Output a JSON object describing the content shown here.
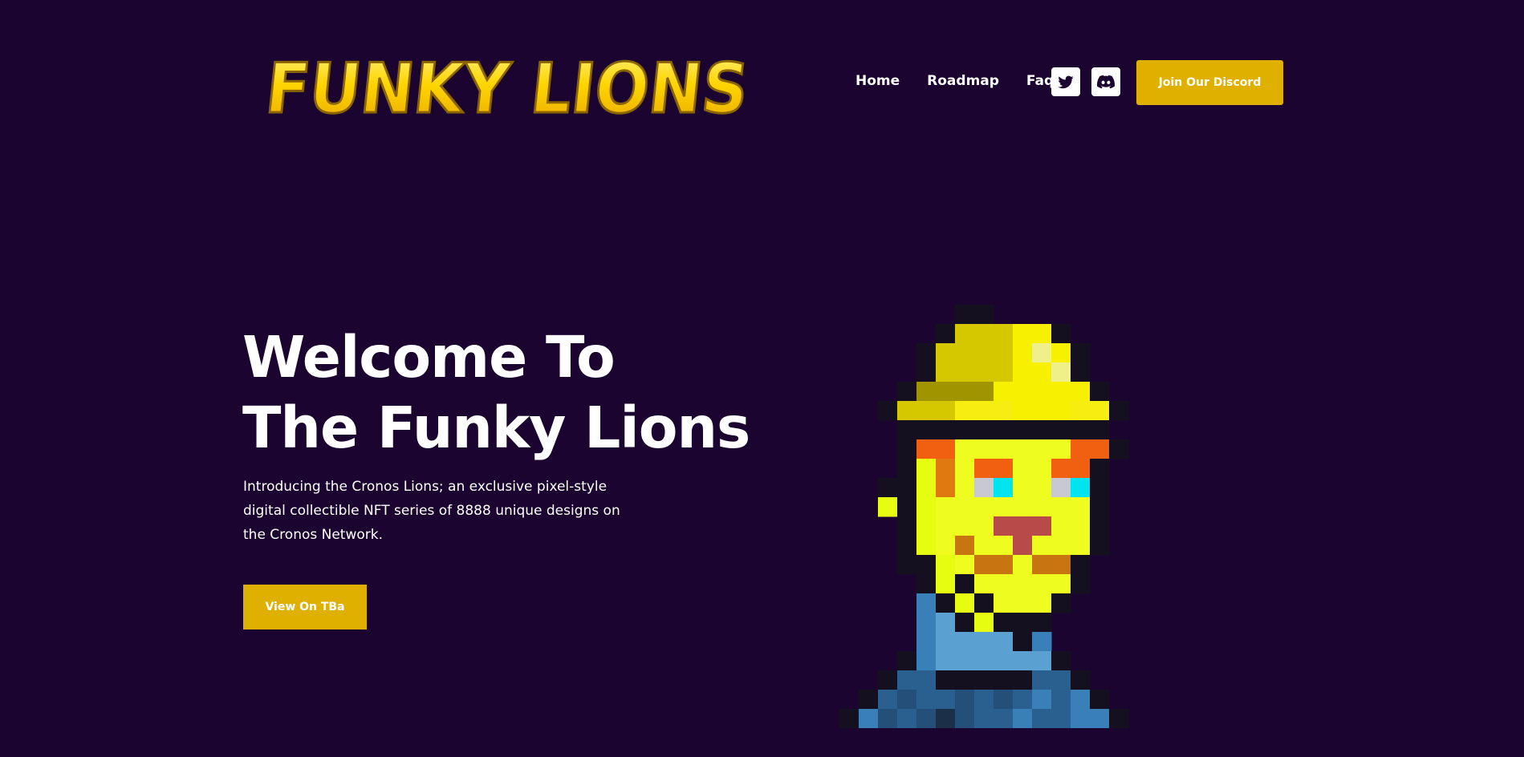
{
  "header": {
    "logo_text": "FUNKY LIONS",
    "nav": [
      {
        "label": "Home"
      },
      {
        "label": "Roadmap"
      },
      {
        "label": "Faq"
      }
    ],
    "social": [
      {
        "icon": "twitter-icon"
      },
      {
        "icon": "discord-icon"
      }
    ],
    "cta_label": "Join Our Discord"
  },
  "hero": {
    "title_line1": "Welcome To",
    "title_line2": "The Funky Lions",
    "description": "Introducing the Cronos Lions; an exclusive pixel-style digital collectible NFT series of 8888 unique designs on the Cronos Network.",
    "button_label": "View On TBa"
  },
  "colors": {
    "background": "#1b0530",
    "accent": "#e0b000",
    "logo_yellow": "#ffd400",
    "text": "#ffffff"
  },
  "illustration": {
    "name": "pixel-lion-with-hat"
  }
}
